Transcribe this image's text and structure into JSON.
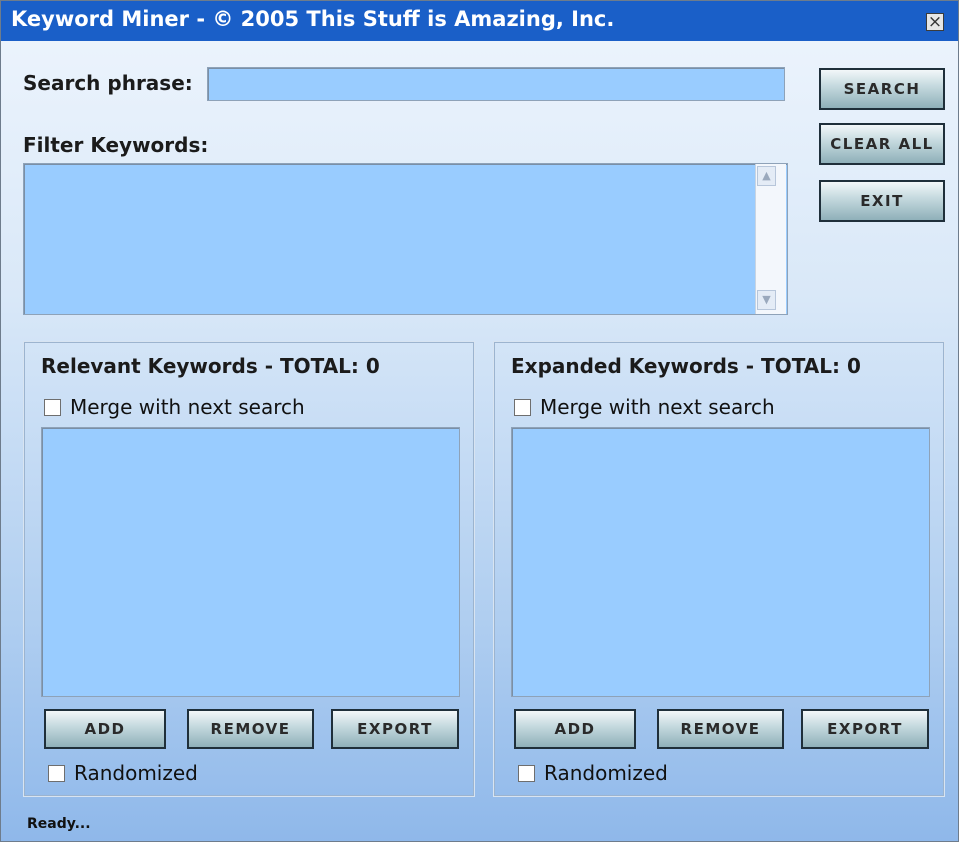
{
  "window": {
    "title": "Keyword Miner - © 2005 This Stuff is Amazing, Inc.",
    "close_glyph": "×"
  },
  "search": {
    "label": "Search phrase:",
    "value": ""
  },
  "filter": {
    "label": "Filter Keywords:",
    "value": "",
    "scroll_up_glyph": "▲",
    "scroll_down_glyph": "▼"
  },
  "buttons": {
    "search": "SEARCH",
    "clear_all": "CLEAR ALL",
    "exit": "EXIT"
  },
  "relevant": {
    "title": "Relevant Keywords - TOTAL: 0",
    "merge_label": "Merge with next search",
    "merge_checked": false,
    "add": "ADD",
    "remove": "REMOVE",
    "export": "EXPORT",
    "randomized_label": "Randomized",
    "randomized_checked": false,
    "items": []
  },
  "expanded": {
    "title": "Expanded Keywords - TOTAL: 0",
    "merge_label": "Merge with next search",
    "merge_checked": false,
    "add": "ADD",
    "remove": "REMOVE",
    "export": "EXPORT",
    "randomized_label": "Randomized",
    "randomized_checked": false,
    "items": []
  },
  "status": {
    "text": "Ready..."
  },
  "colors": {
    "titlebar": "#1a5fc8",
    "field": "#99ccff",
    "button_border": "#1f2f3a"
  },
  "icons": {
    "close": "close-icon",
    "scroll_up": "chevron-up-icon",
    "scroll_down": "chevron-down-icon"
  }
}
